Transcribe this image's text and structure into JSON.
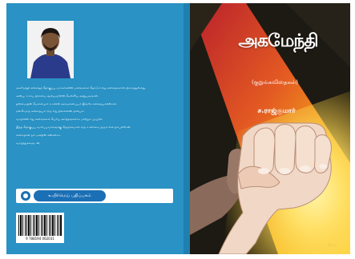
{
  "front_cover": {
    "title": "அகமேந்தி",
    "subtitle": "(குறுங்கவிதைகள்)",
    "author": "ச.ராஜ்குமார்",
    "artist_signature": "நீலா"
  },
  "back_cover": {
    "blurb": [
      "அகமேந்தி கவிதைத் தொகுப்பு வாசகர்களின் மனங்களை தொடும் சிறு கவிதைகளால் நிறைந்துள்ளது.",
      "அன்பு, உறவு, நினைவு ஆகியவற்றின் மெல்லிய அனுபவங்கள்.",
      "தனிமையின் மௌனமும் உறவின் அரவணைப்பும் இங்கே கவிதையாகின்றன.",
      "ஒவ்வொரு கவிதையும் ஒரு சிறு நினைவின் ஓவியம்.",
      "வாழ்வின் சிறு கணங்களை பெரிய அர்த்தங்களாக மாற்றும் முயற்சி.",
      "இந்த தொகுப்பு வாசிப்பவர்களுக்கு நெருக்கமான ஒரு உணர்வை தரும் என நம்புகிறேன்.",
      "கவிதைகள் நம் மனதின் கண்ணாடி.",
      "வாழ்த்துக்களுடன்,"
    ],
    "publisher": "உயிர்மெய் பதிப்பகம்",
    "isbn": "9 788194 062031"
  }
}
